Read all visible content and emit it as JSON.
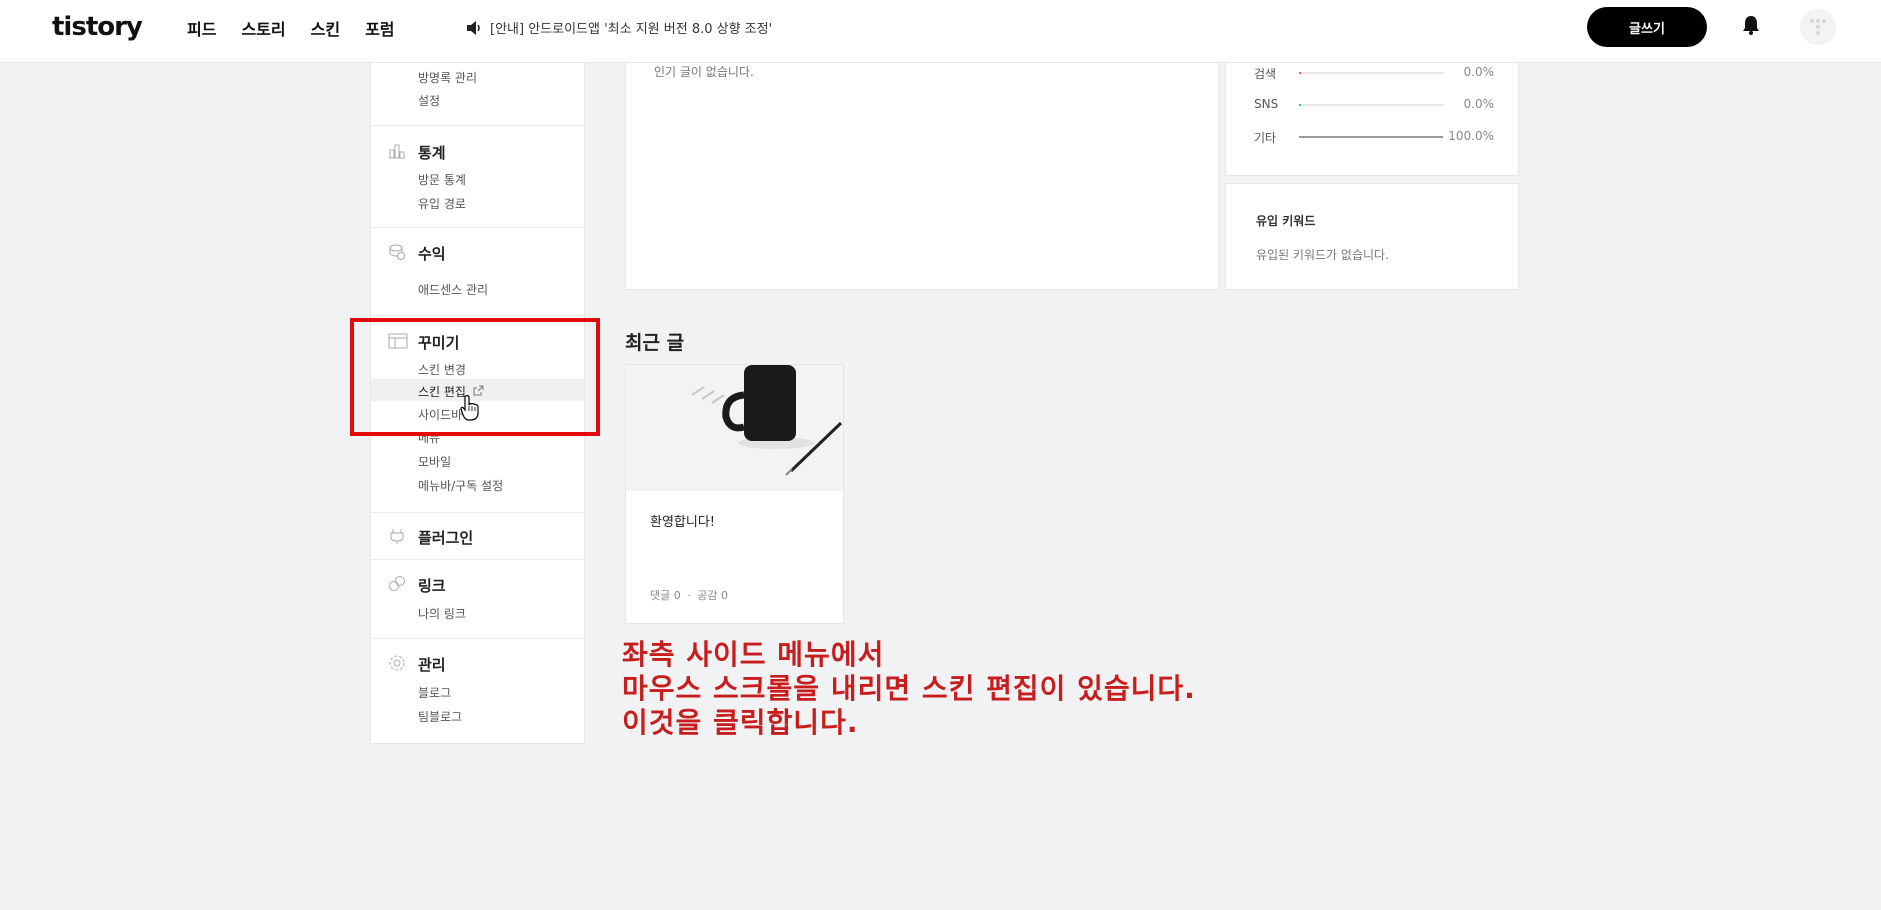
{
  "header": {
    "logo": "tistory",
    "nav": [
      "피드",
      "스토리",
      "스킨",
      "포럼"
    ],
    "notice": "[안내] 안드로이드앱 '최소 지원 버전 8.0 상향 조정'",
    "write_button": "글쓰기"
  },
  "sidebar": {
    "comments_partial": [
      "방명록 관리",
      "설정"
    ],
    "stats": {
      "title": "통계",
      "items": [
        "방문 통계",
        "유입 경로"
      ]
    },
    "revenue": {
      "title": "수익",
      "items": [
        "애드센스 관리"
      ]
    },
    "decorate": {
      "title": "꾸미기",
      "items": [
        "스킨 변경",
        "스킨 편집",
        "사이드바",
        "메뉴",
        "모바일",
        "메뉴바/구독 설정"
      ]
    },
    "plugin": {
      "title": "플러그인"
    },
    "link": {
      "title": "링크",
      "items": [
        "나의 링크"
      ]
    },
    "manage": {
      "title": "관리",
      "items": [
        "블로그",
        "팀블로그"
      ]
    }
  },
  "popular": {
    "empty": "인기 글이 없습니다."
  },
  "traffic": {
    "rows": [
      {
        "label": "검색",
        "value": "0.0%",
        "fraction": 0.0,
        "color": "#f06262"
      },
      {
        "label": "SNS",
        "value": "0.0%",
        "fraction": 0.0,
        "color": "#3fc0c6"
      },
      {
        "label": "기타",
        "value": "100.0%",
        "fraction": 1.0,
        "color": "#999999"
      }
    ]
  },
  "keywords": {
    "title": "유입 키워드",
    "empty": "유입된 키워드가 없습니다."
  },
  "recent": {
    "title": "최근 글",
    "post": {
      "title": "환영합니다!",
      "comments": "댓글 0",
      "likes": "공감 0",
      "separator": "·"
    }
  },
  "annotation": {
    "lines": [
      "좌측 사이드 메뉴에서",
      "마우스 스크롤을 내리면 스킨 편집이 있습니다.",
      "이것을 클릭합니다."
    ],
    "color": "#c81d1d",
    "box_color": "#e30a0a"
  }
}
